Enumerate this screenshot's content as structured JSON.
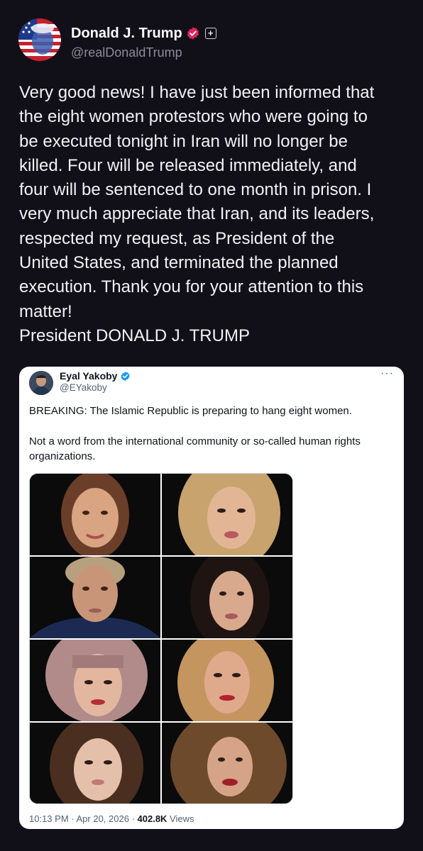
{
  "post": {
    "display_name": "Donald J. Trump",
    "handle": "@realDonaldTrump",
    "verified_icon": "verified-badge-icon",
    "verified_color": "#e0245e",
    "plus_label": "+",
    "text": "Very good news! I have just been informed that the eight women protestors who were going to be executed tonight in Iran will no longer be killed. Four will be released immediately, and four will be sentenced to one month in prison. I very much appreciate that Iran, and its leaders, respected my request, as President of the United States, and terminated the planned execution. Thank you for your attention to this matter!\nPresident DONALD J. TRUMP"
  },
  "embedded_tweet": {
    "display_name": "Eyal Yakoby",
    "handle": "@EYakoby",
    "verified_color": "#1d9bf0",
    "more_label": "···",
    "paragraph1": "BREAKING: The Islamic Republic is preparing to hang eight women.",
    "paragraph2": "Not a word from the international community or so-called human rights organizations.",
    "photo_count": 8,
    "time": "10:13 PM",
    "separator": " · ",
    "date": "Apr 20, 2026",
    "views_count": "402.8K",
    "views_label": " Views"
  },
  "colors": {
    "background": "#111019",
    "card_background": "#ffffff",
    "text_primary": "#f2f2f5",
    "text_secondary": "#8d8c99"
  }
}
